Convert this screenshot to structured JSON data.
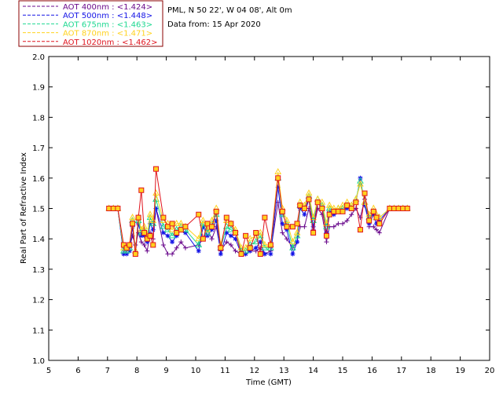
{
  "chart_data": {
    "type": "scatter",
    "title_lines": [
      "PML, N 50 22', W 04 08', Alt 0m",
      "Data from: 15 Apr 2020"
    ],
    "xlabel": "Time (GMT)",
    "ylabel": "Real Part of Refractive Index",
    "xlim": [
      5,
      20
    ],
    "ylim": [
      1.0,
      2.0
    ],
    "xticks": [
      5,
      6,
      7,
      8,
      9,
      10,
      11,
      12,
      13,
      14,
      15,
      16,
      17,
      18,
      19,
      20
    ],
    "yticks": [
      "1.0",
      "1.1",
      "1.2",
      "1.3",
      "1.4",
      "1.5",
      "1.6",
      "1.7",
      "1.8",
      "1.9",
      "2.0"
    ],
    "legend_position": "top-left",
    "series": [
      {
        "name": "AOT  400nm : <1.424>",
        "color": "#6a0a8c",
        "marker": "plus",
        "x": [
          7.05,
          7.2,
          7.35,
          7.55,
          7.65,
          7.75,
          7.85,
          7.95,
          8.05,
          8.15,
          8.25,
          8.35,
          8.45,
          8.55,
          8.65,
          8.9,
          9.05,
          9.2,
          9.35,
          9.5,
          9.65,
          10.1,
          10.25,
          10.4,
          10.55,
          10.7,
          10.85,
          11.05,
          11.2,
          11.35,
          11.55,
          11.7,
          11.85,
          12.05,
          12.2,
          12.35,
          12.55,
          12.8,
          12.95,
          13.1,
          13.3,
          13.45,
          13.55,
          13.7,
          13.85,
          14.0,
          14.15,
          14.3,
          14.45,
          14.55,
          14.7,
          14.85,
          15.0,
          15.15,
          15.3,
          15.45,
          15.6,
          15.75,
          15.9,
          16.05,
          16.15,
          16.25,
          16.6,
          16.75,
          16.9,
          17.05,
          17.2
        ],
        "y": [
          1.5,
          1.5,
          1.5,
          1.35,
          1.36,
          1.37,
          1.41,
          1.38,
          1.42,
          1.39,
          1.38,
          1.36,
          1.42,
          1.4,
          1.5,
          1.38,
          1.35,
          1.35,
          1.37,
          1.39,
          1.37,
          1.38,
          1.4,
          1.43,
          1.4,
          1.44,
          1.36,
          1.39,
          1.38,
          1.36,
          1.35,
          1.35,
          1.36,
          1.36,
          1.37,
          1.35,
          1.36,
          1.52,
          1.42,
          1.4,
          1.37,
          1.39,
          1.44,
          1.44,
          1.5,
          1.43,
          1.5,
          1.48,
          1.39,
          1.44,
          1.44,
          1.45,
          1.45,
          1.46,
          1.48,
          1.5,
          1.47,
          1.53,
          1.44,
          1.44,
          1.43,
          1.42,
          1.5,
          1.5,
          1.5,
          1.5,
          1.5
        ]
      },
      {
        "name": "AOT  500nm : <1.448>",
        "color": "#1414e6",
        "marker": "star",
        "x": [
          7.05,
          7.2,
          7.35,
          7.55,
          7.65,
          7.75,
          7.85,
          7.95,
          8.05,
          8.15,
          8.25,
          8.35,
          8.45,
          8.55,
          8.65,
          8.9,
          9.05,
          9.2,
          9.35,
          9.5,
          9.65,
          10.1,
          10.25,
          10.4,
          10.55,
          10.7,
          10.85,
          11.05,
          11.2,
          11.35,
          11.55,
          11.7,
          11.85,
          12.05,
          12.2,
          12.35,
          12.55,
          12.8,
          12.95,
          13.1,
          13.3,
          13.45,
          13.55,
          13.7,
          13.85,
          14.0,
          14.15,
          14.3,
          14.45,
          14.55,
          14.7,
          14.85,
          15.0,
          15.15,
          15.3,
          15.45,
          15.6,
          15.75,
          15.9,
          16.05,
          16.15,
          16.25,
          16.6,
          16.75,
          16.9,
          17.05,
          17.2
        ],
        "y": [
          1.5,
          1.5,
          1.5,
          1.35,
          1.35,
          1.36,
          1.44,
          1.35,
          1.45,
          1.41,
          1.41,
          1.39,
          1.45,
          1.43,
          1.5,
          1.42,
          1.41,
          1.39,
          1.41,
          1.43,
          1.42,
          1.36,
          1.44,
          1.41,
          1.43,
          1.46,
          1.35,
          1.42,
          1.41,
          1.4,
          1.35,
          1.35,
          1.36,
          1.37,
          1.39,
          1.35,
          1.35,
          1.57,
          1.45,
          1.43,
          1.35,
          1.39,
          1.5,
          1.48,
          1.53,
          1.44,
          1.52,
          1.5,
          1.42,
          1.49,
          1.48,
          1.49,
          1.49,
          1.5,
          1.5,
          1.52,
          1.6,
          1.51,
          1.45,
          1.48,
          1.45,
          1.46,
          1.5,
          1.5,
          1.5,
          1.5,
          1.5
        ]
      },
      {
        "name": "AOT  675nm : <1.463>",
        "color": "#1cd890",
        "marker": "triangle",
        "x": [
          7.05,
          7.2,
          7.35,
          7.55,
          7.65,
          7.75,
          7.85,
          7.95,
          8.05,
          8.15,
          8.25,
          8.35,
          8.45,
          8.55,
          8.65,
          8.9,
          9.05,
          9.2,
          9.35,
          9.5,
          9.65,
          10.1,
          10.25,
          10.4,
          10.55,
          10.7,
          10.85,
          11.05,
          11.2,
          11.35,
          11.55,
          11.7,
          11.85,
          12.05,
          12.2,
          12.35,
          12.55,
          12.8,
          12.95,
          13.1,
          13.3,
          13.45,
          13.55,
          13.7,
          13.85,
          14.0,
          14.15,
          14.3,
          14.45,
          14.55,
          14.7,
          14.85,
          15.0,
          15.15,
          15.3,
          15.45,
          15.6,
          15.75,
          15.9,
          16.05,
          16.15,
          16.25,
          16.6,
          16.75,
          16.9,
          17.05,
          17.2
        ],
        "y": [
          1.5,
          1.5,
          1.5,
          1.36,
          1.36,
          1.37,
          1.46,
          1.36,
          1.46,
          1.42,
          1.43,
          1.4,
          1.47,
          1.45,
          1.53,
          1.44,
          1.43,
          1.41,
          1.43,
          1.44,
          1.43,
          1.38,
          1.45,
          1.42,
          1.45,
          1.48,
          1.37,
          1.44,
          1.43,
          1.42,
          1.36,
          1.36,
          1.38,
          1.39,
          1.41,
          1.37,
          1.37,
          1.6,
          1.48,
          1.45,
          1.37,
          1.41,
          1.51,
          1.5,
          1.54,
          1.46,
          1.53,
          1.51,
          1.44,
          1.5,
          1.49,
          1.5,
          1.5,
          1.51,
          1.51,
          1.53,
          1.59,
          1.52,
          1.47,
          1.49,
          1.47,
          1.47,
          1.5,
          1.5,
          1.5,
          1.5,
          1.5
        ]
      },
      {
        "name": "AOT  870nm : <1.471>",
        "color": "#ffd21e",
        "marker": "triangle",
        "x": [
          7.05,
          7.2,
          7.35,
          7.55,
          7.65,
          7.75,
          7.85,
          7.95,
          8.05,
          8.15,
          8.25,
          8.35,
          8.45,
          8.55,
          8.65,
          8.9,
          9.05,
          9.2,
          9.35,
          9.5,
          9.65,
          10.1,
          10.25,
          10.4,
          10.55,
          10.7,
          10.85,
          11.05,
          11.2,
          11.35,
          11.55,
          11.7,
          11.85,
          12.05,
          12.2,
          12.35,
          12.55,
          12.8,
          12.95,
          13.1,
          13.3,
          13.45,
          13.55,
          13.7,
          13.85,
          14.0,
          14.15,
          14.3,
          14.45,
          14.55,
          14.7,
          14.85,
          15.0,
          15.15,
          15.3,
          15.45,
          15.6,
          15.75,
          15.9,
          16.05,
          16.15,
          16.25,
          16.6,
          16.75,
          16.9,
          17.05,
          17.2
        ],
        "y": [
          1.5,
          1.5,
          1.5,
          1.37,
          1.37,
          1.38,
          1.47,
          1.36,
          1.47,
          1.43,
          1.44,
          1.41,
          1.48,
          1.46,
          1.55,
          1.46,
          1.45,
          1.43,
          1.45,
          1.45,
          1.44,
          1.4,
          1.46,
          1.43,
          1.46,
          1.5,
          1.38,
          1.46,
          1.45,
          1.43,
          1.37,
          1.37,
          1.4,
          1.41,
          1.42,
          1.38,
          1.38,
          1.62,
          1.5,
          1.46,
          1.39,
          1.42,
          1.52,
          1.51,
          1.55,
          1.47,
          1.53,
          1.52,
          1.45,
          1.51,
          1.5,
          1.5,
          1.51,
          1.52,
          1.51,
          1.53,
          1.58,
          1.52,
          1.48,
          1.5,
          1.48,
          1.47,
          1.5,
          1.5,
          1.5,
          1.5,
          1.5
        ]
      },
      {
        "name": "AOT 1020nm : <1.462>",
        "color": "#e0141e",
        "marker": "square",
        "x": [
          7.05,
          7.2,
          7.35,
          7.55,
          7.65,
          7.75,
          7.85,
          7.95,
          8.05,
          8.15,
          8.25,
          8.35,
          8.45,
          8.55,
          8.65,
          8.9,
          9.05,
          9.2,
          9.35,
          9.5,
          9.65,
          10.1,
          10.25,
          10.4,
          10.55,
          10.7,
          10.85,
          11.05,
          11.2,
          11.35,
          11.55,
          11.7,
          11.85,
          12.05,
          12.2,
          12.35,
          12.55,
          12.8,
          12.95,
          13.1,
          13.3,
          13.45,
          13.55,
          13.7,
          13.85,
          14.0,
          14.15,
          14.3,
          14.45,
          14.55,
          14.7,
          14.85,
          15.0,
          15.15,
          15.3,
          15.45,
          15.6,
          15.75,
          15.9,
          16.05,
          16.15,
          16.25,
          16.6,
          16.75,
          16.9,
          17.05,
          17.2
        ],
        "y": [
          1.5,
          1.5,
          1.5,
          1.38,
          1.37,
          1.38,
          1.45,
          1.35,
          1.47,
          1.56,
          1.42,
          1.4,
          1.41,
          1.38,
          1.63,
          1.47,
          1.44,
          1.45,
          1.42,
          1.43,
          1.44,
          1.48,
          1.4,
          1.45,
          1.44,
          1.49,
          1.37,
          1.47,
          1.45,
          1.42,
          1.35,
          1.41,
          1.37,
          1.42,
          1.35,
          1.47,
          1.38,
          1.6,
          1.49,
          1.44,
          1.44,
          1.45,
          1.51,
          1.5,
          1.53,
          1.42,
          1.52,
          1.5,
          1.41,
          1.48,
          1.49,
          1.49,
          1.49,
          1.51,
          1.5,
          1.52,
          1.43,
          1.55,
          1.46,
          1.49,
          1.47,
          1.45,
          1.5,
          1.5,
          1.5,
          1.5,
          1.5
        ]
      }
    ]
  }
}
